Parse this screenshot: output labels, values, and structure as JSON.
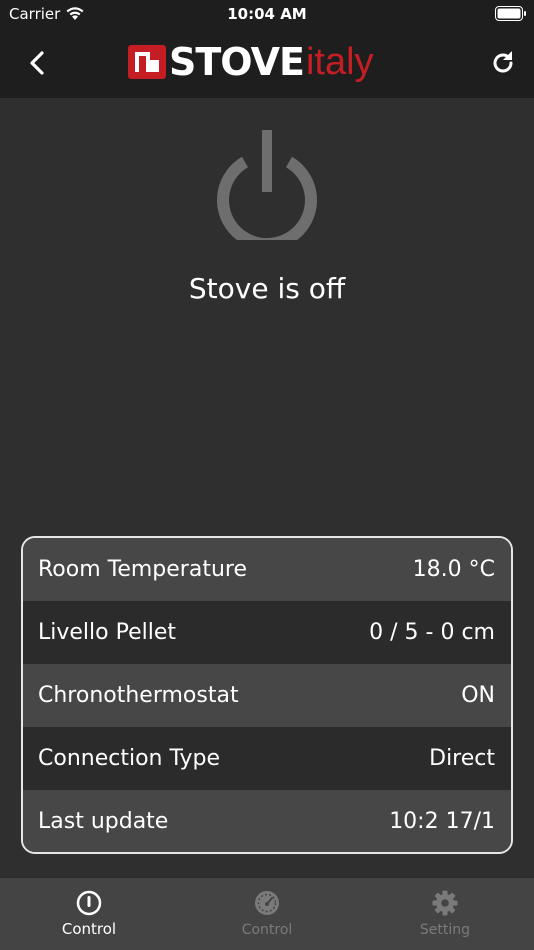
{
  "status_bar": {
    "carrier": "Carrier",
    "time": "10:04 AM"
  },
  "nav": {
    "back_icon": "chevron-left-icon",
    "refresh_icon": "refresh-icon",
    "logo_brand": "STOVE",
    "logo_suffix": "italy",
    "logo_color": "#c41e24"
  },
  "main": {
    "power_icon": "power-icon",
    "status_text": "Stove is off"
  },
  "info": {
    "rows": [
      {
        "label": "Room Temperature",
        "value": "18.0 °C"
      },
      {
        "label": "Livello Pellet",
        "value": "0 / 5 - 0 cm"
      },
      {
        "label": "Chronothermostat",
        "value": "ON"
      },
      {
        "label": "Connection Type",
        "value": "Direct"
      },
      {
        "label": "Last update",
        "value": "10:2 17/1"
      }
    ]
  },
  "tabs": [
    {
      "label": "Control",
      "icon": "power-circle-icon",
      "active": true
    },
    {
      "label": "Control",
      "icon": "gauge-icon",
      "active": false
    },
    {
      "label": "Setting",
      "icon": "gear-icon",
      "active": false
    }
  ]
}
